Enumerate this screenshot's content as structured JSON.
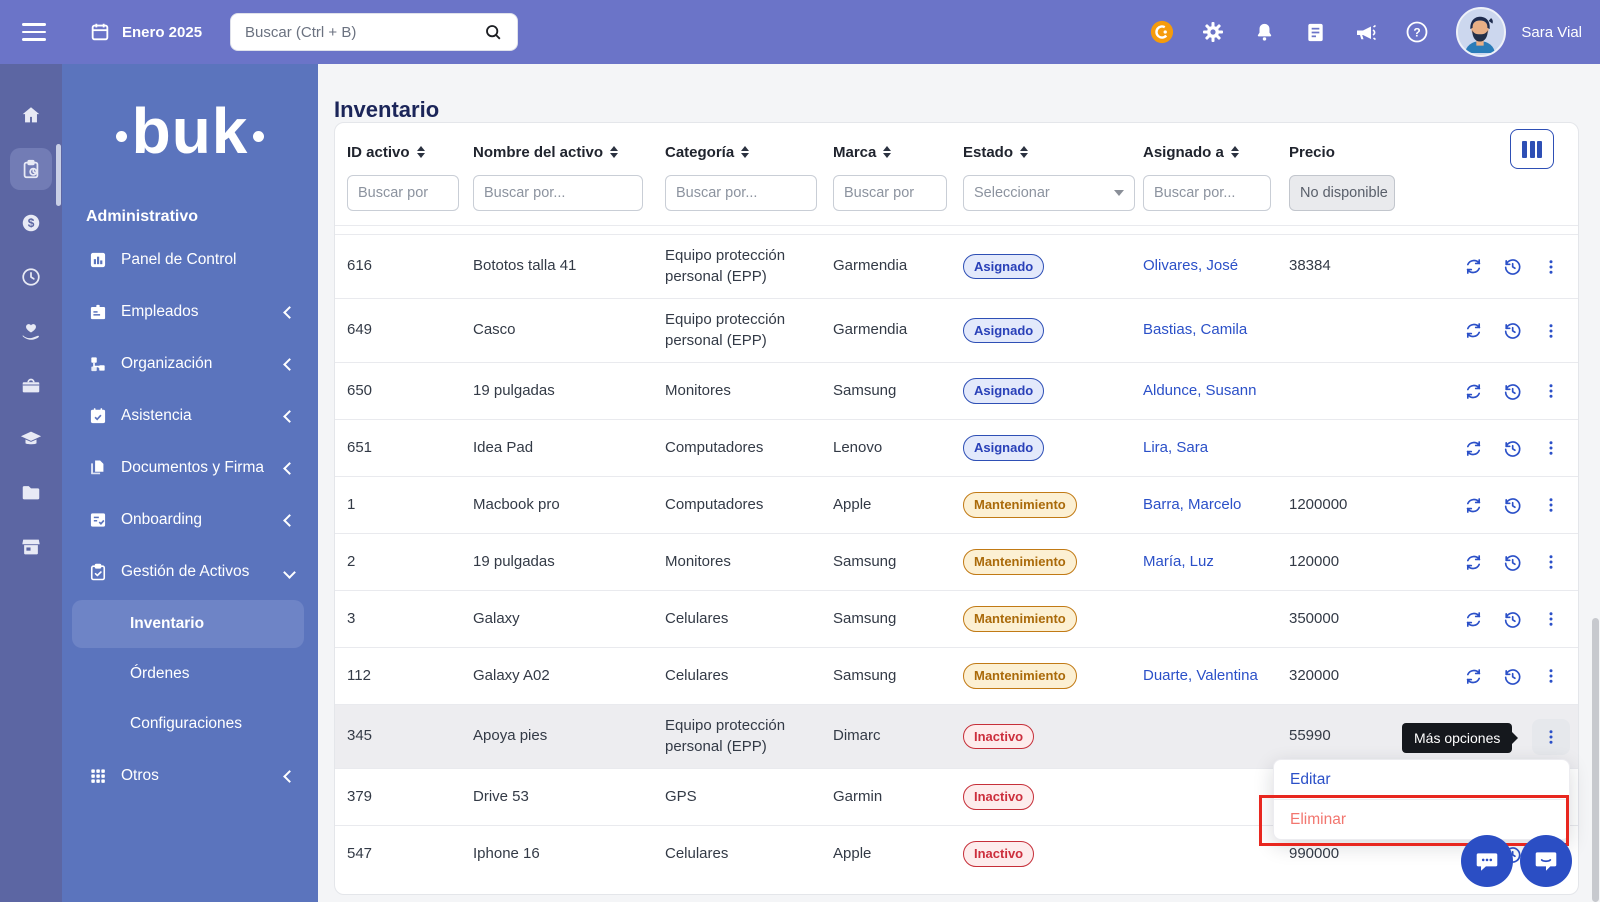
{
  "topbar": {
    "date": "Enero 2025",
    "search_placeholder": "Buscar (Ctrl + B)",
    "user_name": "Sara Vial",
    "right_icons": [
      "whats-new-icon",
      "settings-icon",
      "notifications-icon",
      "news-icon",
      "announcements-icon",
      "help-icon"
    ]
  },
  "rail": {
    "icons": [
      {
        "name": "home-icon",
        "active": false
      },
      {
        "name": "assets-clipboard-icon",
        "active": true
      },
      {
        "name": "payroll-dollar-icon",
        "active": false
      },
      {
        "name": "time-clock-icon",
        "active": false
      },
      {
        "name": "wellness-hand-heart-icon",
        "active": false
      },
      {
        "name": "benefits-box-icon",
        "active": false
      },
      {
        "name": "training-graduation-icon",
        "active": false
      },
      {
        "name": "files-folder-icon",
        "active": false
      },
      {
        "name": "marketplace-store-icon",
        "active": false
      }
    ]
  },
  "sidebar": {
    "logo_text": "buk",
    "section_label": "Administrativo",
    "items": [
      {
        "label": "Panel de Control",
        "icon": "panel-icon",
        "chevron": ""
      },
      {
        "label": "Empleados",
        "icon": "employees-icon",
        "chevron": "left"
      },
      {
        "label": "Organización",
        "icon": "org-icon",
        "chevron": "left"
      },
      {
        "label": "Asistencia",
        "icon": "attendance-icon",
        "chevron": "left"
      },
      {
        "label": "Documentos y Firma",
        "icon": "documents-icon",
        "chevron": "left"
      },
      {
        "label": "Onboarding",
        "icon": "onboarding-icon",
        "chevron": "left"
      },
      {
        "label": "Gestión de Activos",
        "icon": "asset-mgmt-icon",
        "chevron": "down",
        "expanded": true
      }
    ],
    "subitems": [
      {
        "label": "Inventario",
        "active": true
      },
      {
        "label": "Órdenes",
        "active": false
      },
      {
        "label": "Configuraciones",
        "active": false
      }
    ],
    "after_items": [
      {
        "label": "Otros",
        "icon": "others-grid-icon",
        "chevron": "left"
      }
    ]
  },
  "main": {
    "title": "Inventario",
    "columns": [
      {
        "label": "ID activo",
        "sortable": true,
        "filter": {
          "type": "text",
          "placeholder": "Buscar por"
        }
      },
      {
        "label": "Nombre del activo",
        "sortable": true,
        "filter": {
          "type": "text",
          "placeholder": "Buscar por..."
        }
      },
      {
        "label": "Categoría",
        "sortable": true,
        "filter": {
          "type": "text",
          "placeholder": "Buscar por..."
        }
      },
      {
        "label": "Marca",
        "sortable": true,
        "filter": {
          "type": "text",
          "placeholder": "Buscar por"
        }
      },
      {
        "label": "Estado",
        "sortable": true,
        "filter": {
          "type": "select",
          "placeholder": "Seleccionar"
        }
      },
      {
        "label": "Asignado a",
        "sortable": true,
        "filter": {
          "type": "text",
          "placeholder": "Buscar por..."
        }
      },
      {
        "label": "Precio",
        "sortable": false,
        "filter": {
          "type": "disabled",
          "value": "No disponible"
        }
      }
    ],
    "row_actions": [
      "reassign-icon",
      "history-icon",
      "more-options-icon"
    ],
    "rows": [
      {
        "id": "616",
        "name": "Bototos talla 41",
        "category": "Equipo protección personal (EPP)",
        "brand": "Garmendia",
        "status": "Asignado",
        "assignee": "Olivares, José",
        "price": "38384",
        "tall": true
      },
      {
        "id": "649",
        "name": "Casco",
        "category": "Equipo protección personal (EPP)",
        "brand": "Garmendia",
        "status": "Asignado",
        "assignee": "Bastias, Camila",
        "price": "",
        "tall": true
      },
      {
        "id": "650",
        "name": "19 pulgadas",
        "category": "Monitores",
        "brand": "Samsung",
        "status": "Asignado",
        "assignee": "Aldunce, Susann",
        "price": ""
      },
      {
        "id": "651",
        "name": "Idea Pad",
        "category": "Computadores",
        "brand": "Lenovo",
        "status": "Asignado",
        "assignee": "Lira, Sara",
        "price": ""
      },
      {
        "id": "1",
        "name": "Macbook pro",
        "category": "Computadores",
        "brand": "Apple",
        "status": "Mantenimiento",
        "assignee": "Barra, Marcelo",
        "price": "1200000"
      },
      {
        "id": "2",
        "name": "19 pulgadas",
        "category": "Monitores",
        "brand": "Samsung",
        "status": "Mantenimiento",
        "assignee": "María, Luz",
        "price": "120000"
      },
      {
        "id": "3",
        "name": "Galaxy",
        "category": "Celulares",
        "brand": "Samsung",
        "status": "Mantenimiento",
        "assignee": "",
        "price": "350000"
      },
      {
        "id": "112",
        "name": "Galaxy A02",
        "category": "Celulares",
        "brand": "Samsung",
        "status": "Mantenimiento",
        "assignee": "Duarte, Valentina",
        "price": "320000"
      },
      {
        "id": "345",
        "name": "Apoya pies",
        "category": "Equipo protección personal (EPP)",
        "brand": "Dimarc",
        "status": "Inactivo",
        "assignee": "",
        "price": "55990",
        "tall": true,
        "hovered": true
      },
      {
        "id": "379",
        "name": "Drive 53",
        "category": "GPS",
        "brand": "Garmin",
        "status": "Inactivo",
        "assignee": "",
        "price": ""
      },
      {
        "id": "547",
        "name": "Iphone 16",
        "category": "Celulares",
        "brand": "Apple",
        "status": "Inactivo",
        "assignee": "",
        "price": "990000"
      }
    ],
    "status_colors": {
      "Asignado": {
        "bg": "#e3e9fb",
        "border": "#2e4fb5",
        "text": "#2940b8"
      },
      "Mantenimiento": {
        "bg": "#fcf0d3",
        "border": "#c17a15",
        "text": "#aa6a0a"
      },
      "Inactivo": {
        "bg": "#fdecec",
        "border": "#c62f39",
        "text": "#cc2f3d"
      }
    }
  },
  "overlay": {
    "tooltip": "Más opciones",
    "menu_items": [
      {
        "label": "Editar"
      },
      {
        "label": "Eliminar"
      }
    ],
    "annotation_color": "#e8271f",
    "chat_icons": [
      "chat-bubble-icon",
      "chat-message-icon"
    ]
  },
  "colors": {
    "topbar": "#6b74c8",
    "rail": "#5c66a3",
    "sidebar": "#5b74bd",
    "accent": "#2b50c8",
    "title": "#1b2559",
    "tooltip_bg": "#15181d",
    "chat_button": "#2b4ec4",
    "whats_new": "#f59b0c"
  }
}
